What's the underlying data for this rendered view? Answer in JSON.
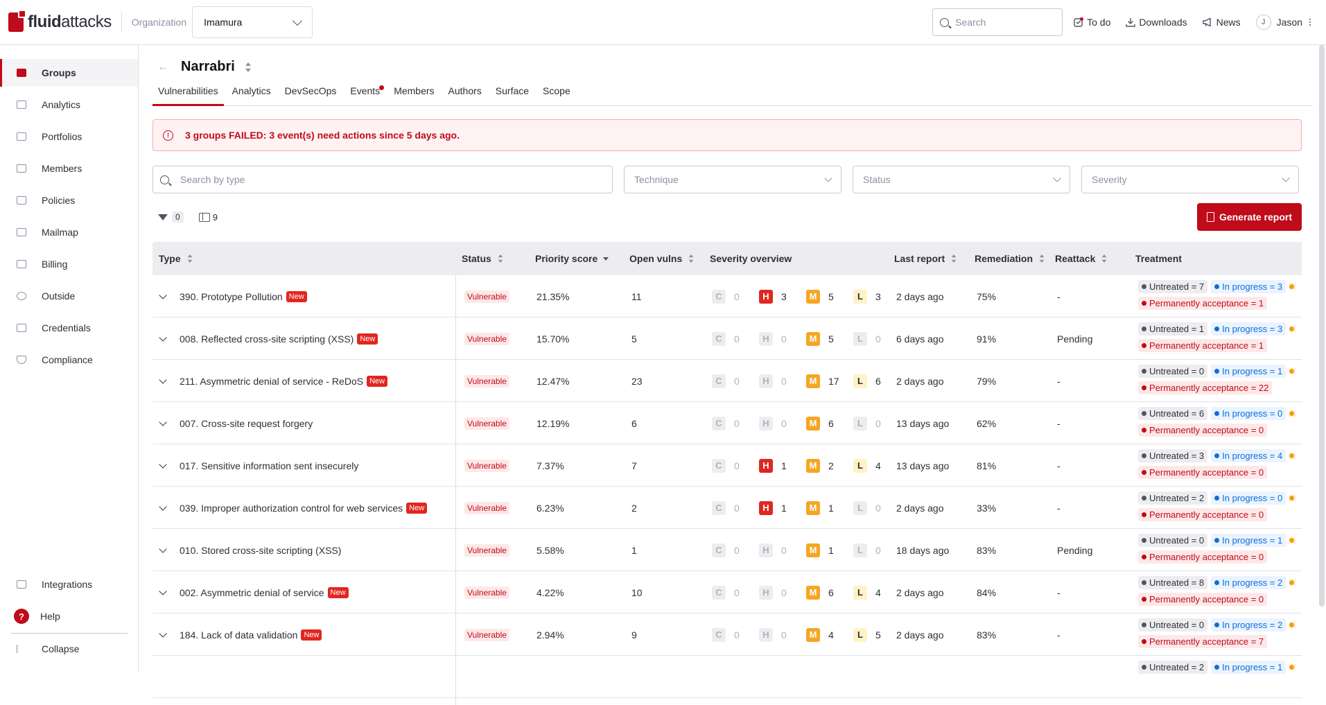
{
  "brand": {
    "logo_bold": "fluid",
    "logo_light": "attacks"
  },
  "topbar": {
    "org_label": "Organization",
    "org_value": "Imamura",
    "search_placeholder": "Search",
    "todo": "To do",
    "downloads": "Downloads",
    "news": "News",
    "avatar_initial": "J",
    "user": "Jason"
  },
  "sidebar": {
    "items": [
      {
        "label": "Groups"
      },
      {
        "label": "Analytics"
      },
      {
        "label": "Portfolios"
      },
      {
        "label": "Members"
      },
      {
        "label": "Policies"
      },
      {
        "label": "Mailmap"
      },
      {
        "label": "Billing"
      },
      {
        "label": "Outside"
      },
      {
        "label": "Credentials"
      },
      {
        "label": "Compliance"
      }
    ],
    "integrations": "Integrations",
    "help": "Help",
    "help_icon": "?",
    "collapse": "Collapse"
  },
  "header": {
    "title": "Narrabri"
  },
  "tabs": [
    "Vulnerabilities",
    "Analytics",
    "DevSecOps",
    "Events",
    "Members",
    "Authors",
    "Surface",
    "Scope"
  ],
  "alert": {
    "message": "3 groups FAILED: 3 event(s) need actions since 5 days ago."
  },
  "filters": {
    "search_placeholder": "Search by type",
    "technique": "Technique",
    "status": "Status",
    "severity": "Severity"
  },
  "toolbar": {
    "filter_count": "0",
    "column_count": "9",
    "generate_report": "Generate report"
  },
  "table": {
    "headers": {
      "type": "Type",
      "status": "Status",
      "priority": "Priority score",
      "open": "Open vulns",
      "severity": "Severity overview",
      "last_report": "Last report",
      "remediation": "Remediation",
      "reattack": "Reattack",
      "treatment": "Treatment"
    },
    "rows": [
      {
        "type": "390. Prototype Pollution",
        "new": "New",
        "status": "Vulnerable",
        "priority": "21.35%",
        "open": "11",
        "c": "0",
        "h": "3",
        "m": "5",
        "l": "3",
        "last": "2 days ago",
        "remediation": "75%",
        "reattack": "-",
        "untreated": "Untreated = 7",
        "progress": "In progress = 3",
        "perm": "Permanently acceptance = 1"
      },
      {
        "type": "008. Reflected cross-site scripting (XSS)",
        "new": "New",
        "status": "Vulnerable",
        "priority": "15.70%",
        "open": "5",
        "c": "0",
        "h": "0",
        "m": "5",
        "l": "0",
        "last": "6 days ago",
        "remediation": "91%",
        "reattack": "Pending",
        "untreated": "Untreated = 1",
        "progress": "In progress = 3",
        "perm": "Permanently acceptance = 1"
      },
      {
        "type": "211. Asymmetric denial of service - ReDoS",
        "new": "New",
        "status": "Vulnerable",
        "priority": "12.47%",
        "open": "23",
        "c": "0",
        "h": "0",
        "m": "17",
        "l": "6",
        "last": "2 days ago",
        "remediation": "79%",
        "reattack": "-",
        "untreated": "Untreated = 0",
        "progress": "In progress = 1",
        "perm": "Permanently acceptance = 22"
      },
      {
        "type": "007. Cross-site request forgery",
        "new": "",
        "status": "Vulnerable",
        "priority": "12.19%",
        "open": "6",
        "c": "0",
        "h": "0",
        "m": "6",
        "l": "0",
        "last": "13 days ago",
        "remediation": "62%",
        "reattack": "-",
        "untreated": "Untreated = 6",
        "progress": "In progress = 0",
        "perm": "Permanently acceptance = 0"
      },
      {
        "type": "017. Sensitive information sent insecurely",
        "new": "",
        "status": "Vulnerable",
        "priority": "7.37%",
        "open": "7",
        "c": "0",
        "h": "1",
        "m": "2",
        "l": "4",
        "last": "13 days ago",
        "remediation": "81%",
        "reattack": "-",
        "untreated": "Untreated = 3",
        "progress": "In progress = 4",
        "perm": "Permanently acceptance = 0"
      },
      {
        "type": "039. Improper authorization control for web services",
        "new": "New",
        "status": "Vulnerable",
        "priority": "6.23%",
        "open": "2",
        "c": "0",
        "h": "1",
        "m": "1",
        "l": "0",
        "last": "2 days ago",
        "remediation": "33%",
        "reattack": "-",
        "untreated": "Untreated = 2",
        "progress": "In progress = 0",
        "perm": "Permanently acceptance = 0"
      },
      {
        "type": "010. Stored cross-site scripting (XSS)",
        "new": "",
        "status": "Vulnerable",
        "priority": "5.58%",
        "open": "1",
        "c": "0",
        "h": "0",
        "m": "1",
        "l": "0",
        "last": "18  days ago",
        "remediation": "83%",
        "reattack": "Pending",
        "untreated": "Untreated = 0",
        "progress": "In progress = 1",
        "perm": "Permanently acceptance = 0"
      },
      {
        "type": "002. Asymmetric denial of service",
        "new": "New",
        "status": "Vulnerable",
        "priority": "4.22%",
        "open": "10",
        "c": "0",
        "h": "0",
        "m": "6",
        "l": "4",
        "last": "2 days ago",
        "remediation": "84%",
        "reattack": "-",
        "untreated": "Untreated = 8",
        "progress": "In progress = 2",
        "perm": "Permanently acceptance = 0"
      },
      {
        "type": "184. Lack of data validation",
        "new": "New",
        "status": "Vulnerable",
        "priority": "2.94%",
        "open": "9",
        "c": "0",
        "h": "0",
        "m": "4",
        "l": "5",
        "last": "2 days ago",
        "remediation": "83%",
        "reattack": "-",
        "untreated": "Untreated = 0",
        "progress": "In progress = 2",
        "perm": "Permanently acceptance = 7"
      },
      {
        "type": "",
        "new": "",
        "status": "",
        "priority": "",
        "open": "",
        "c": "",
        "h": "",
        "m": "",
        "l": "",
        "last": "",
        "remediation": "",
        "reattack": "",
        "untreated": "Untreated = 2",
        "progress": "In progress = 1",
        "perm": ""
      }
    ]
  },
  "colors": {
    "brand_red": "#bf0b1a",
    "high": "#e0271f",
    "medium": "#f5a623",
    "low": "#fff2c4",
    "in_progress": "#0e6ed8"
  }
}
